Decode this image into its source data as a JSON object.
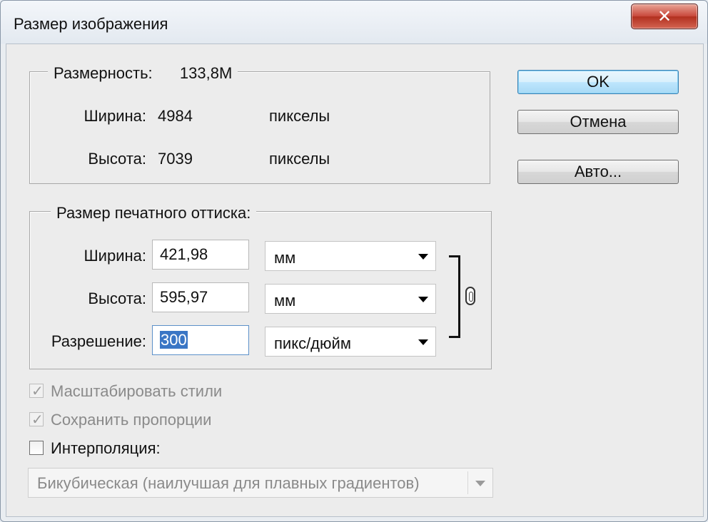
{
  "window": {
    "title": "Размер изображения"
  },
  "pixel_dimensions": {
    "legend_label": "Размерность:",
    "legend_value": "133,8M",
    "width_label": "Ширина:",
    "width_value": "4984",
    "width_unit": "пикселы",
    "height_label": "Высота:",
    "height_value": "7039",
    "height_unit": "пикселы"
  },
  "document_size": {
    "legend": "Размер печатного оттиска:",
    "width_label": "Ширина:",
    "width_value": "421,98",
    "width_unit": "мм",
    "height_label": "Высота:",
    "height_value": "595,97",
    "height_unit": "мм",
    "resolution_label": "Разрешение:",
    "resolution_value": "300",
    "resolution_unit": "пикс/дюйм"
  },
  "buttons": {
    "ok": "OK",
    "cancel": "Отмена",
    "auto": "Авто..."
  },
  "options": {
    "scale_styles": {
      "label": "Масштабировать стили",
      "checked": true,
      "enabled": false
    },
    "constrain": {
      "label": "Сохранить пропорции",
      "checked": true,
      "enabled": false
    },
    "resample": {
      "label": "Интерполяция:",
      "checked": false,
      "enabled": true
    }
  },
  "interpolation_method": {
    "value": "Бикубическая (наилучшая для плавных градиентов)",
    "enabled": false
  },
  "icons": {
    "close": "close-icon",
    "link": "chain-link-icon",
    "dropdown": "chevron-down-icon"
  },
  "colors": {
    "selection": "#3a76c5",
    "close_button": "#c8473a",
    "default_button_border": "#3c7fb1"
  }
}
